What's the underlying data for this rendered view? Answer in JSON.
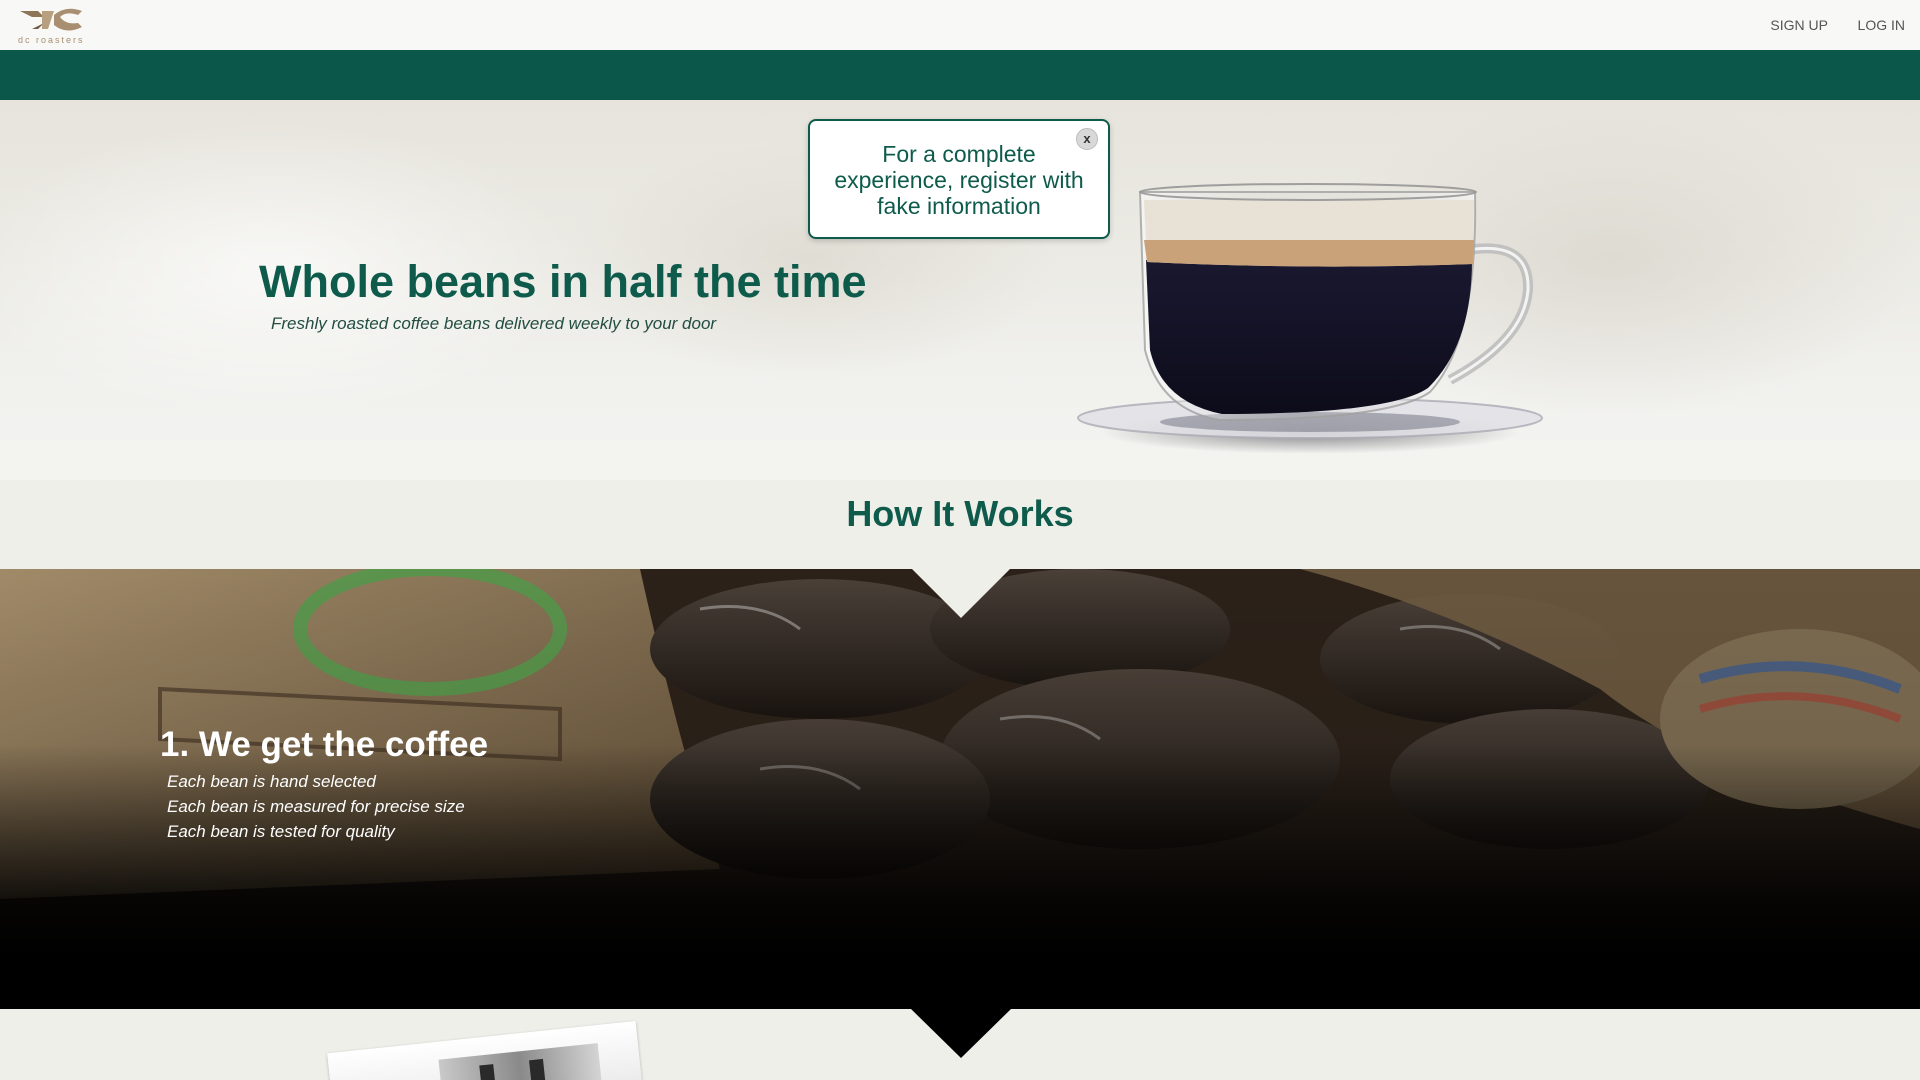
{
  "nav": {
    "logo_text": "dc roasters",
    "signup_label": "SIGN UP",
    "login_label": "LOG IN"
  },
  "hero": {
    "title": "Whole beans in half the time",
    "subtitle": "Freshly roasted coffee beans delivered weekly to your door"
  },
  "popup": {
    "message": "For a complete experience, register with fake information",
    "close_label": "x"
  },
  "how_it_works": {
    "title": "How It Works",
    "step1": {
      "title": "1. We get the coffee",
      "lines": [
        "Each bean is hand selected",
        "Each bean is measured for precise size",
        "Each bean is tested for quality"
      ]
    }
  },
  "colors": {
    "brand_green": "#0b5749",
    "text_green": "#0e5b4c",
    "logo_brown": "#a88f72",
    "page_bg": "#efefea"
  }
}
